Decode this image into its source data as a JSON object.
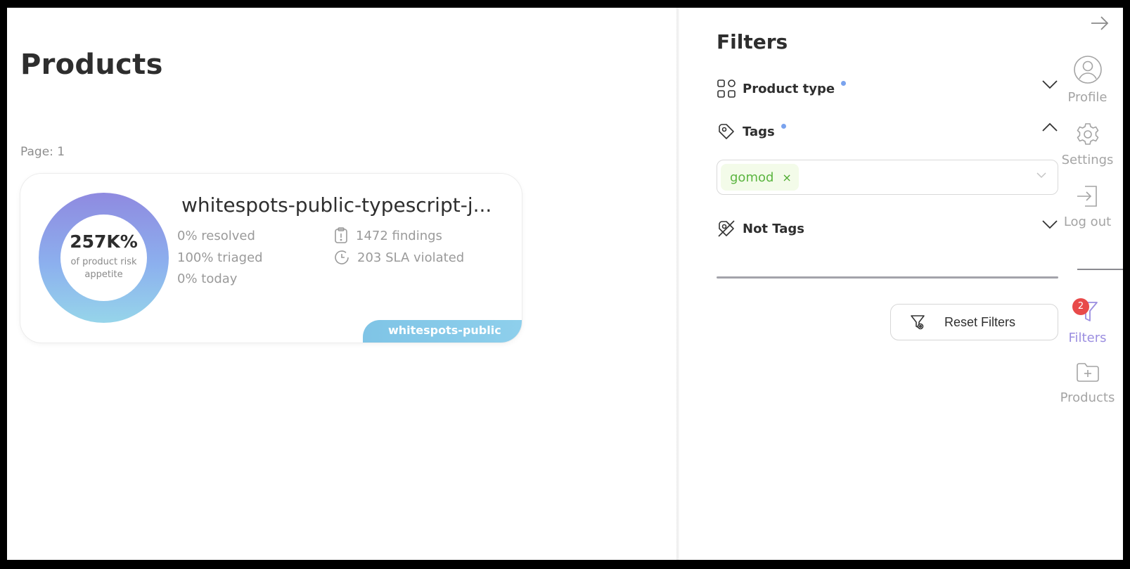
{
  "main": {
    "title": "Products",
    "page_indicator": "Page: 1"
  },
  "product_card": {
    "risk_percent": "257K%",
    "risk_caption": "of product risk appetite",
    "name": "whitespots-public-typescript-j...",
    "stats": {
      "resolved": "0% resolved",
      "triaged": "100% triaged",
      "today": "0% today",
      "findings": "1472 findings",
      "sla_violated": "203 SLA violated"
    },
    "group_tag": "whitespots-public",
    "colors": {
      "donut_top": "#8f8ae0",
      "donut_bottom": "#96d5ea",
      "group_tag_bg": "#8fd0ec"
    }
  },
  "filters": {
    "title": "Filters",
    "product_type": {
      "label": "Product type",
      "active": true,
      "expanded": false,
      "icon": "grid-icon"
    },
    "tags": {
      "label": "Tags",
      "active": true,
      "expanded": true,
      "icon": "tag-icon",
      "selected": [
        {
          "label": "gomod",
          "remove": "×"
        }
      ]
    },
    "not_tags": {
      "label": "Not Tags",
      "active": false,
      "expanded": false,
      "icon": "tag-off-icon"
    },
    "reset_label": "Reset Filters",
    "colors": {
      "active_dot": "#7aa3ee",
      "chip_bg": "#f3fbe9",
      "chip_text": "#5bb540"
    }
  },
  "rail": {
    "collapse_icon": "arrow-right-icon",
    "profile": "Profile",
    "settings": "Settings",
    "logout": "Log out",
    "filters": "Filters",
    "filters_badge": "2",
    "products": "Products",
    "colors": {
      "active": "#9b8ee0",
      "badge": "#e84a4a"
    }
  }
}
